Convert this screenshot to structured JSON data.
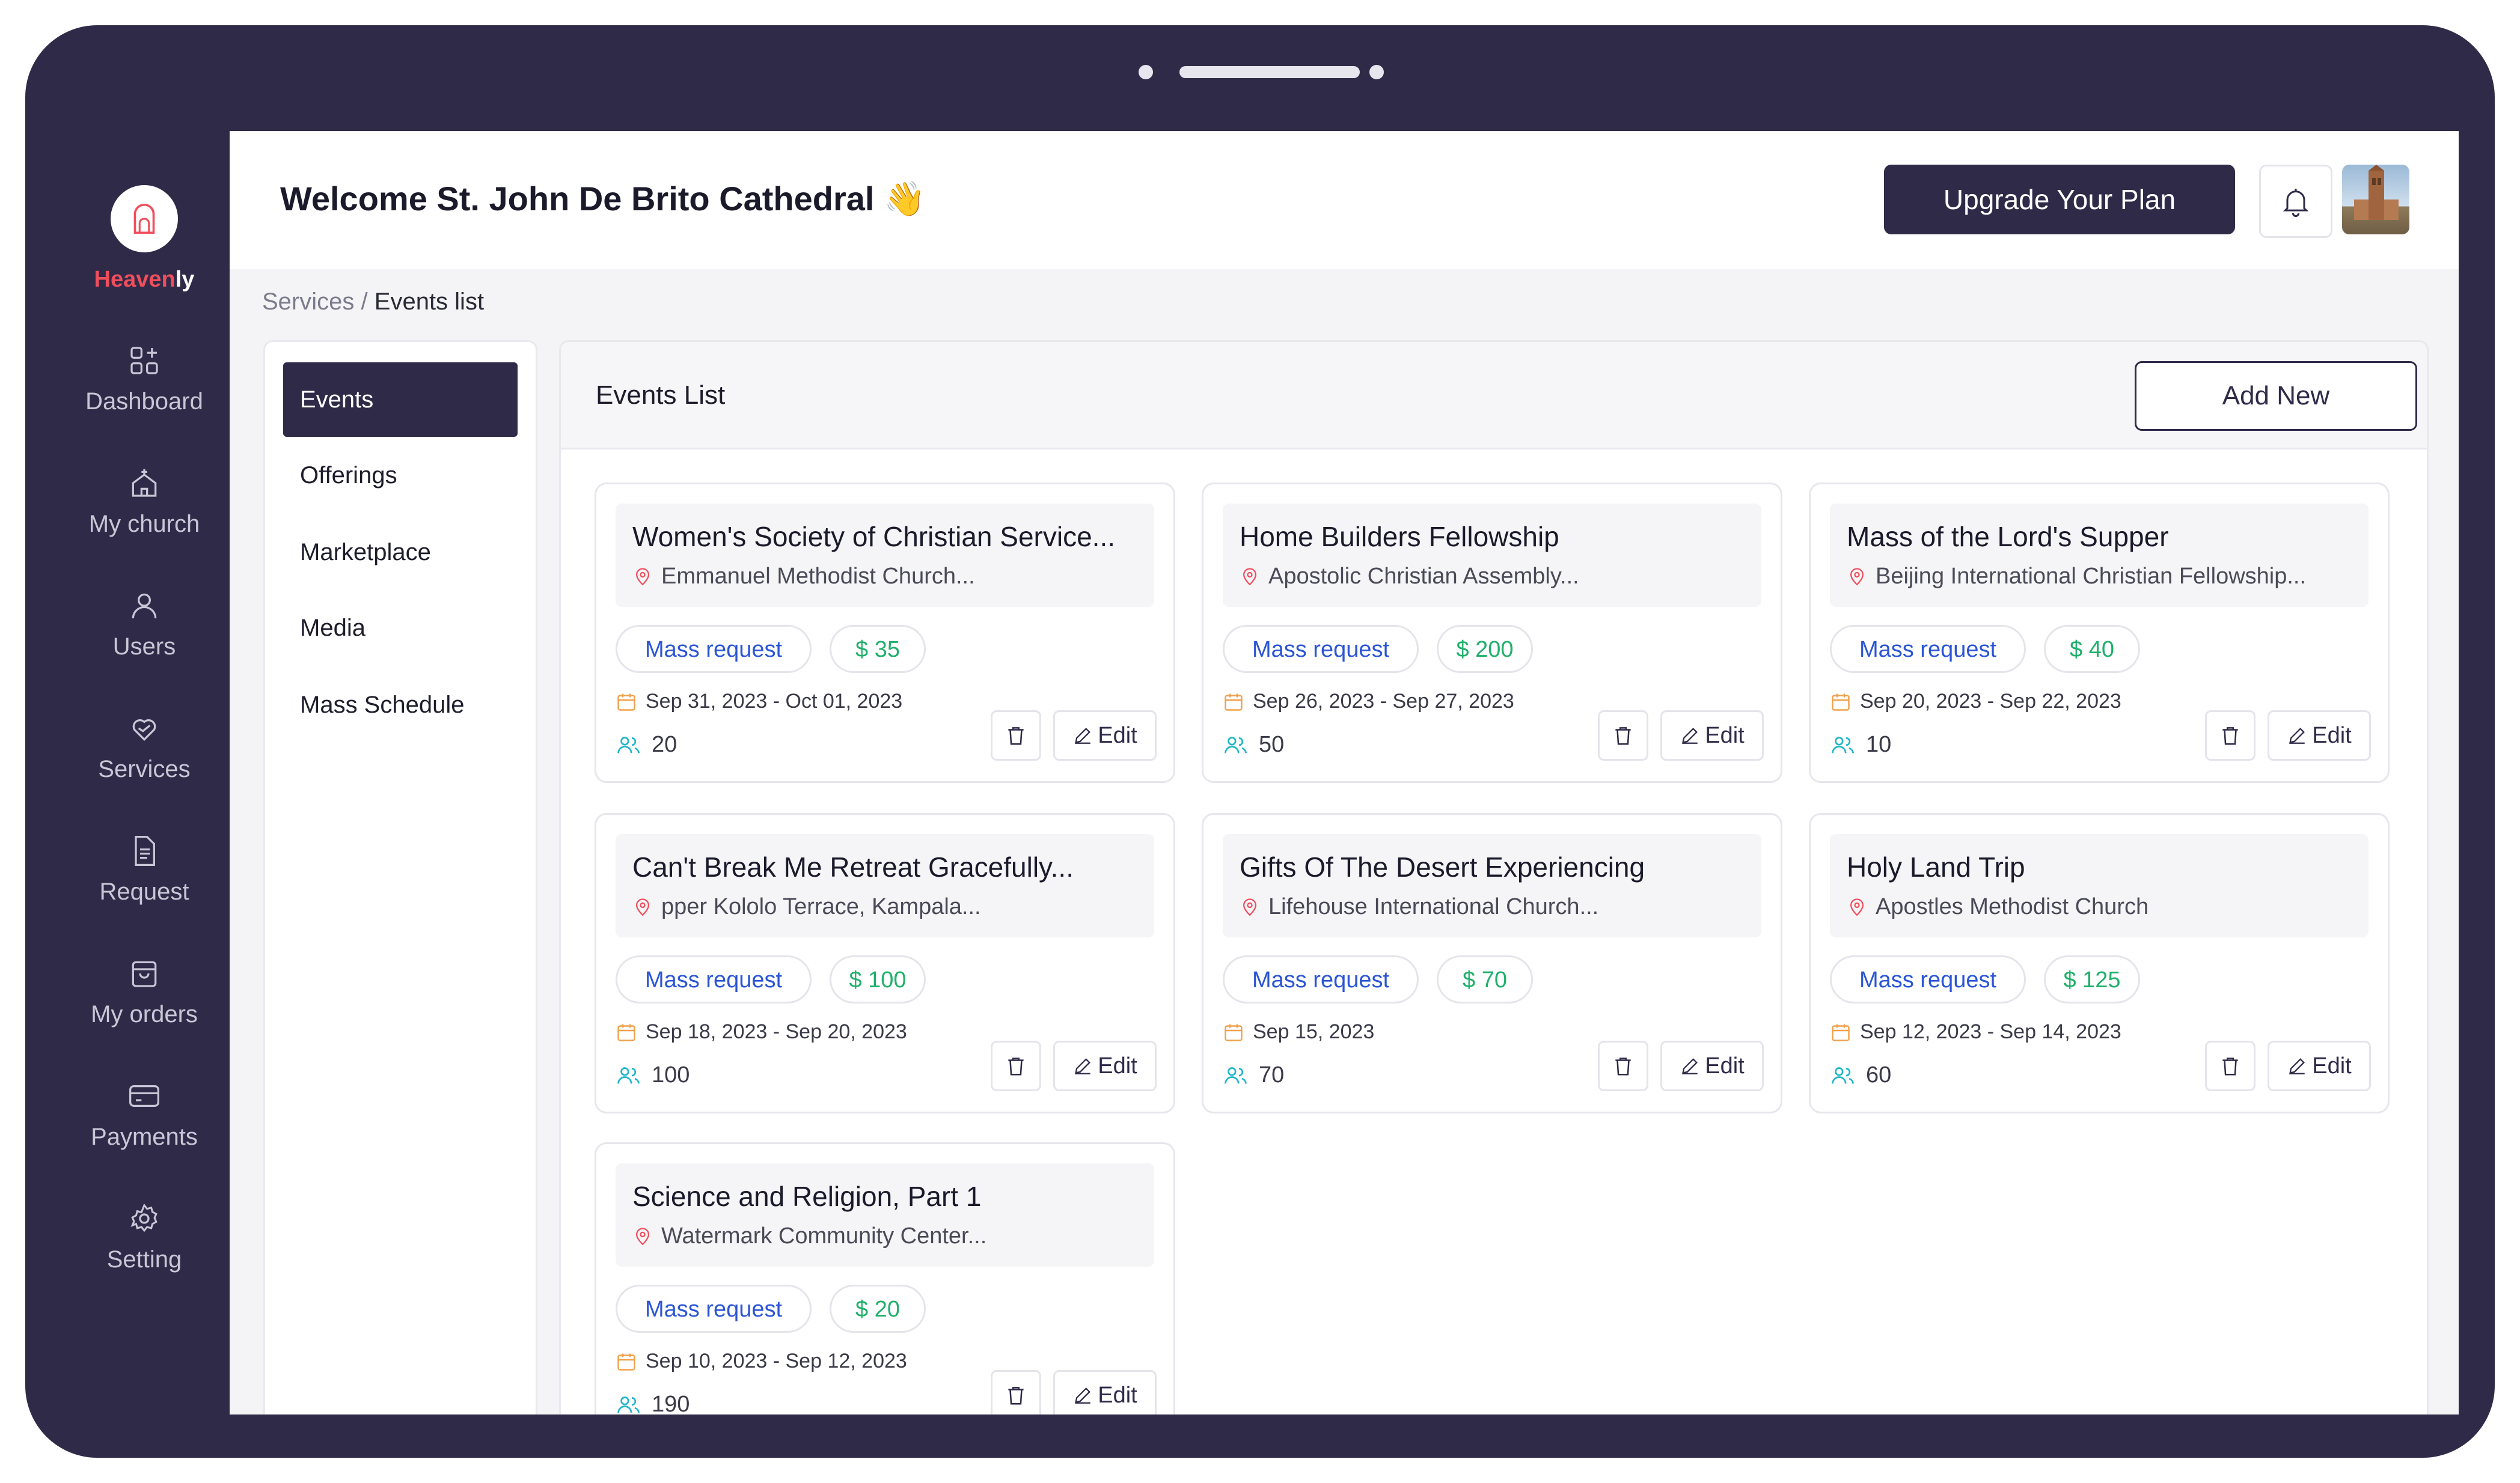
{
  "brand": {
    "name_part1": "Heaven",
    "name_part2": "ly"
  },
  "sidebar": {
    "items": [
      {
        "label": "Dashboard",
        "icon": "grid-plus-icon"
      },
      {
        "label": "My church",
        "icon": "church-icon"
      },
      {
        "label": "Users",
        "icon": "user-icon"
      },
      {
        "label": "Services",
        "icon": "heart-hand-icon"
      },
      {
        "label": "Request",
        "icon": "document-icon"
      },
      {
        "label": "My orders",
        "icon": "shopping-bag-icon"
      },
      {
        "label": "Payments",
        "icon": "credit-card-icon"
      },
      {
        "label": "Setting",
        "icon": "gear-icon"
      }
    ]
  },
  "header": {
    "welcome": "Welcome St. John De Brito Cathedral 👋",
    "upgrade_label": "Upgrade Your Plan"
  },
  "breadcrumb": {
    "parent": "Services",
    "separator": "/",
    "current": "Events list"
  },
  "submenu": {
    "items": [
      {
        "label": "Events",
        "active": true
      },
      {
        "label": "Offerings",
        "active": false
      },
      {
        "label": "Marketplace",
        "active": false
      },
      {
        "label": "Media",
        "active": false
      },
      {
        "label": "Mass Schedule",
        "active": false
      }
    ]
  },
  "events_panel": {
    "title": "Events List",
    "add_label": "Add New"
  },
  "events": [
    {
      "title": "Women's Society of Christian Service...",
      "location": "Emmanuel Methodist Church...",
      "tag": "Mass request",
      "price": "$ 35",
      "dates": "Sep 31, 2023 - Oct 01, 2023",
      "attendees": "20",
      "edit": "Edit"
    },
    {
      "title": "Home Builders Fellowship",
      "location": "Apostolic Christian Assembly...",
      "tag": "Mass request",
      "price": "$ 200",
      "dates": "Sep 26, 2023 - Sep 27, 2023",
      "attendees": "50",
      "edit": "Edit"
    },
    {
      "title": "Mass of the Lord's Supper",
      "location": "Beijing International Christian Fellowship...",
      "tag": "Mass request",
      "price": "$ 40",
      "dates": "Sep 20, 2023 - Sep 22, 2023",
      "attendees": "10",
      "edit": "Edit"
    },
    {
      "title": "Can't Break Me Retreat Gracefully...",
      "location": "pper Kololo Terrace, Kampala...",
      "tag": "Mass request",
      "price": "$ 100",
      "dates": "Sep 18, 2023 - Sep 20, 2023",
      "attendees": "100",
      "edit": "Edit"
    },
    {
      "title": "Gifts Of The Desert Experiencing",
      "location": "Lifehouse International Church...",
      "tag": "Mass request",
      "price": "$ 70",
      "dates": "Sep 15, 2023",
      "attendees": "70",
      "edit": "Edit"
    },
    {
      "title": "Holy Land Trip",
      "location": "Apostles Methodist Church",
      "tag": "Mass request",
      "price": "$ 125",
      "dates": "Sep 12, 2023 - Sep 14, 2023",
      "attendees": "60",
      "edit": "Edit"
    },
    {
      "title": "Science and Religion, Part 1",
      "location": "Watermark Community Center...",
      "tag": "Mass request",
      "price": "$ 20",
      "dates": "Sep 10, 2023 - Sep 12, 2023",
      "attendees": "190",
      "edit": "Edit"
    }
  ],
  "colors": {
    "frame": "#2f2a48",
    "accent_red": "#f04e5c",
    "tag_blue": "#2b55d6",
    "price_green": "#20b06b",
    "date_orange": "#f0a04b",
    "people_teal": "#1fb6c9"
  }
}
